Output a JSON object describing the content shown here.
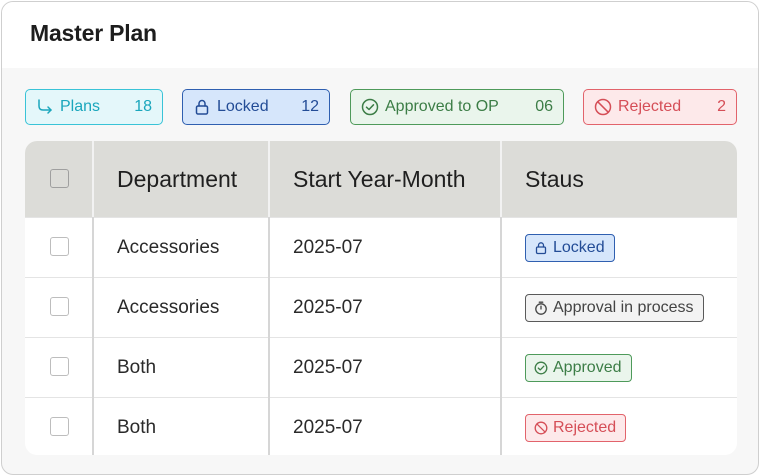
{
  "card": {
    "title": "Master Plan"
  },
  "summary": [
    {
      "label": "Plans",
      "count": "18",
      "icon": "arrow-turn-down-right-icon",
      "color": "#1aa6bc"
    },
    {
      "label": "Locked",
      "count": "12",
      "icon": "lock-icon",
      "color": "#234c96"
    },
    {
      "label": "Approved to OP",
      "count": "06",
      "icon": "check-circle-icon",
      "color": "#3c7d46"
    },
    {
      "label": "Rejected",
      "count": "2",
      "icon": "prohibited-icon",
      "color": "#d54e57"
    }
  ],
  "table": {
    "headers": {
      "department": "Department",
      "start": "Start Year-Month",
      "status": "Staus"
    },
    "rows": [
      {
        "department": "Accessories",
        "start": "2025-07",
        "status": "Locked"
      },
      {
        "department": "Accessories",
        "start": "2025-07",
        "status": "Approval in process"
      },
      {
        "department": "Both",
        "start": "2025-07",
        "status": "Approved"
      },
      {
        "department": "Both",
        "start": "2025-07",
        "status": "Rejected"
      }
    ]
  }
}
